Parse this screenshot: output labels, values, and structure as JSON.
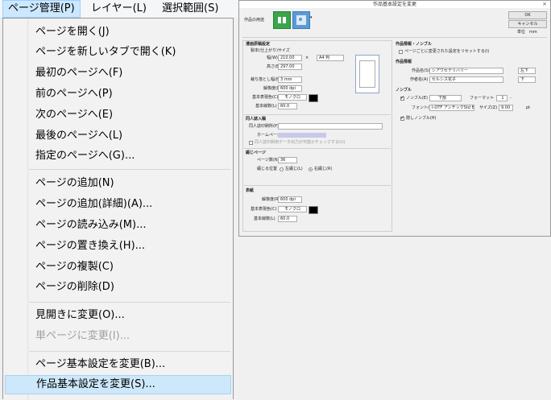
{
  "menubar": {
    "items": [
      "ページ管理(P)",
      "レイヤー(L)",
      "選択範囲(S)"
    ]
  },
  "menu": {
    "items": [
      {
        "label": "ページを開く(J)",
        "enabled": true
      },
      {
        "label": "ページを新しいタブで開く(K)",
        "enabled": true
      },
      {
        "label": "最初のページへ(F)",
        "enabled": true
      },
      {
        "label": "前のページへ(P)",
        "enabled": true
      },
      {
        "label": "次のページへ(E)",
        "enabled": true
      },
      {
        "label": "最後のページへ(L)",
        "enabled": true
      },
      {
        "label": "指定のページへ(G)...",
        "enabled": true
      },
      {
        "label": "ページの追加(N)",
        "enabled": true
      },
      {
        "label": "ページの追加(詳細)(A)...",
        "enabled": true
      },
      {
        "label": "ページの読み込み(M)...",
        "enabled": true
      },
      {
        "label": "ページの置き換え(H)...",
        "enabled": true
      },
      {
        "label": "ページの複製(C)",
        "enabled": true
      },
      {
        "label": "ページの削除(D)",
        "enabled": true
      },
      {
        "label": "見開きに変更(O)...",
        "enabled": true
      },
      {
        "label": "単ページに変更(I)...",
        "enabled": false
      },
      {
        "label": "ページ基本設定を変更(B)...",
        "enabled": true
      },
      {
        "label": "作品基本設定を変更(S)...",
        "enabled": true,
        "highlighted": true
      }
    ]
  },
  "dialog": {
    "title": "作品基本設定を変更",
    "close": "×",
    "purpose_label": "作品の用途",
    "ok": "OK",
    "cancel": "キャンセル",
    "unit_label": "単位",
    "unit_value": "mm",
    "left": {
      "section_basic": "漫画原稿設定",
      "size_label": "製本(仕上がり)サイズ",
      "width_label": "幅(W)",
      "width_value": "210.00",
      "height_label": "高さ(E)",
      "height_value": "297.00",
      "preset": "A4 判",
      "bleed_label": "裁ち落とし幅(B)",
      "bleed_value": "3 mm",
      "res_label": "解像度(R)",
      "res_value": "600 dpi",
      "color_label": "基本表現色(C)",
      "color_value": "モノクロ",
      "lpi_label": "基本線数(L)",
      "lpi_value": "60.0",
      "doujin_section": "同人誌入稿",
      "doujin_print_label": "同人誌印刷所(P)",
      "homepage_label": "ホームページ",
      "doujin_check": "同人誌印刷用データ出力が可能かチェックする(U)",
      "bind_section": "綴じページ",
      "pages_label": "ページ数(N)",
      "pages_value": "36",
      "bind_pos_label": "綴じる位置",
      "bind_left": "左綴じ(L)",
      "bind_right": "右綴じ(R)",
      "cover_section": "表紙",
      "cover_res_label": "解像度(R)",
      "cover_res_value": "600 dpi",
      "cover_color_label": "基本表現色(C)",
      "cover_color_value": "モノクロ",
      "cover_lpi_label": "基本線数(L)",
      "cover_lpi_value": "60.0"
    },
    "right": {
      "info_nombre_section": "作品情報・ノンブル",
      "info_check": "ページごとに変更された設定をリセットする(I)",
      "info_section": "作品情報",
      "title_label": "作品名(S)",
      "title_value": "シアワセデリバリー",
      "title_pos": "左下",
      "author_label": "作者名(A)",
      "author_value": "セルシス花子",
      "author_pos": "下",
      "nombre_section": "ノンブル",
      "nombre_check": "ノンブル(E)",
      "nombre_pos": "下部",
      "format_label": "フォーマット",
      "format_dash1": "-",
      "format_num": "1",
      "format_dash2": "-",
      "font_label": "フォント(F)",
      "font_value": "I-OTF アンチックStd B",
      "size_label": "サイズ(Z)",
      "size_value": "9.00",
      "size_unit": "pt",
      "hidden_check": "隠しノンブル(H)"
    }
  },
  "colors": {
    "menu_highlight": "#cde8fa",
    "menubar_active": "#cce8ff",
    "green_icon": "#3aa54a",
    "blue_icon": "#5a9bd5"
  }
}
